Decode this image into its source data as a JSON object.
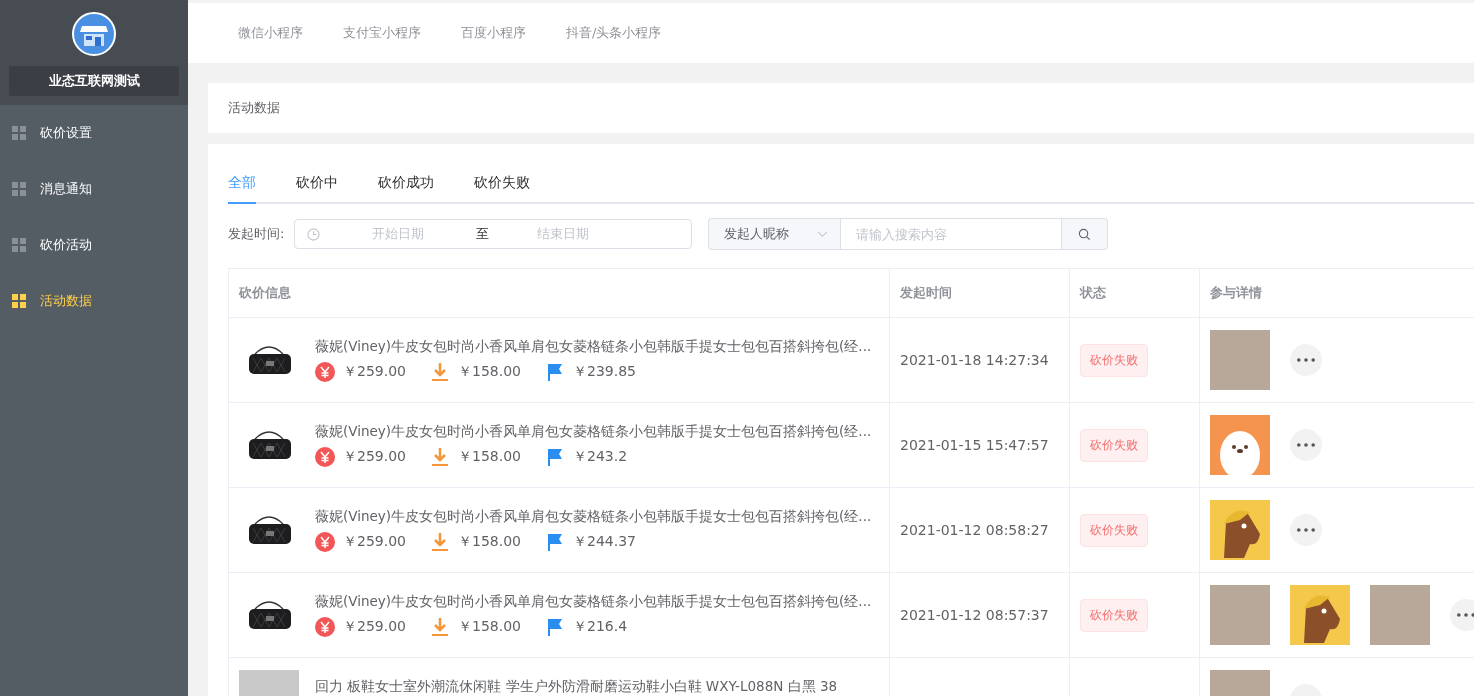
{
  "sidebar": {
    "shop_name": "业态互联网测试",
    "items": [
      {
        "label": "砍价设置",
        "selected": false
      },
      {
        "label": "消息通知",
        "selected": false
      },
      {
        "label": "砍价活动",
        "selected": false
      },
      {
        "label": "活动数据",
        "selected": true
      }
    ]
  },
  "platform_tabs": [
    {
      "label": "微信小程序"
    },
    {
      "label": "支付宝小程序"
    },
    {
      "label": "百度小程序"
    },
    {
      "label": "抖音/头条小程序"
    }
  ],
  "page_title": "活动数据",
  "status_tabs": [
    {
      "label": "全部",
      "selected": true
    },
    {
      "label": "砍价中",
      "selected": false
    },
    {
      "label": "砍价成功",
      "selected": false
    },
    {
      "label": "砍价失败",
      "selected": false
    }
  ],
  "filter": {
    "time_label": "发起时间:",
    "start_placeholder": "开始日期",
    "separator": "至",
    "end_placeholder": "结束日期",
    "search_type": "发起人昵称",
    "search_placeholder": "请输入搜索内容"
  },
  "table": {
    "columns": [
      "砍价信息",
      "发起时间",
      "状态",
      "参与详情"
    ],
    "rows": [
      {
        "image": {
          "kind": "bag"
        },
        "title": "薇妮(Viney)牛皮女包时尚小香风单肩包女菱格链条小包韩版手提女士包包百搭斜挎包(经...",
        "original_price": "￥259.00",
        "floor_price": "￥158.00",
        "current_price": "￥239.85",
        "time": "2021-01-18 14:27:34",
        "status": "砍价失败",
        "participants": [
          {
            "kind": "photo"
          }
        ]
      },
      {
        "image": {
          "kind": "bag"
        },
        "title": "薇妮(Viney)牛皮女包时尚小香风单肩包女菱格链条小包韩版手提女士包包百搭斜挎包(经...",
        "original_price": "￥259.00",
        "floor_price": "￥158.00",
        "current_price": "￥243.2",
        "time": "2021-01-15 15:47:57",
        "status": "砍价失败",
        "participants": [
          {
            "kind": "dog"
          }
        ]
      },
      {
        "image": {
          "kind": "bag"
        },
        "title": "薇妮(Viney)牛皮女包时尚小香风单肩包女菱格链条小包韩版手提女士包包百搭斜挎包(经...",
        "original_price": "￥259.00",
        "floor_price": "￥158.00",
        "current_price": "￥244.37",
        "time": "2021-01-12 08:58:27",
        "status": "砍价失败",
        "participants": [
          {
            "kind": "horse"
          }
        ]
      },
      {
        "image": {
          "kind": "bag"
        },
        "title": "薇妮(Viney)牛皮女包时尚小香风单肩包女菱格链条小包韩版手提女士包包百搭斜挎包(经...",
        "original_price": "￥259.00",
        "floor_price": "￥158.00",
        "current_price": "￥216.4",
        "time": "2021-01-12 08:57:37",
        "status": "砍价失败",
        "participants": [
          {
            "kind": "photo"
          },
          {
            "kind": "horse"
          },
          {
            "kind": "photo"
          }
        ]
      },
      {
        "image": {
          "kind": "photo"
        },
        "title": "回力 板鞋女士室外潮流休闲鞋 学生户外防滑耐磨运动鞋小白鞋 WXY-L088N 白黑 38",
        "participants": [
          {
            "kind": "photo"
          }
        ]
      }
    ]
  }
}
